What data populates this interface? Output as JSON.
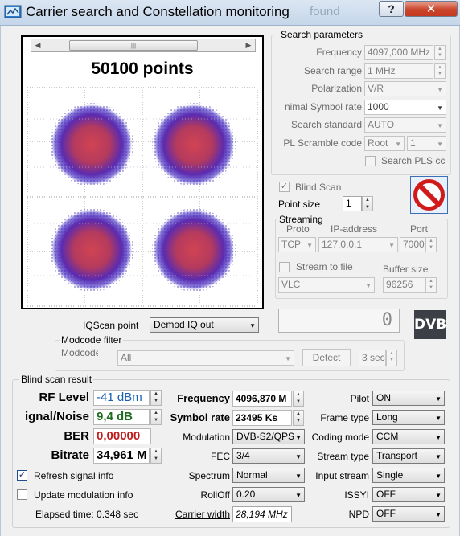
{
  "window": {
    "title": "Carrier search and Constellation monitoring",
    "background_text": "found",
    "help_label": "?",
    "close_label": "✕"
  },
  "plot": {
    "points_label": "50100 points",
    "scroll_thumb": "|||",
    "scroll_left": "◀",
    "scroll_right": "▶"
  },
  "search": {
    "group_label": "Search parameters",
    "frequency_label": "Frequency",
    "frequency_value": "4097,000 MHz",
    "range_label": "Search range",
    "range_value": "1 MHz",
    "polarization_label": "Polarization",
    "polarization_value": "V/R",
    "symbol_label": "nimal Symbol rate",
    "symbol_value": "1000",
    "standard_label": "Search standard",
    "standard_value": "AUTO",
    "pl_label": "PL Scramble code",
    "pl_mode": "Root",
    "pl_value": "1",
    "pls_label": "Search PLS cc"
  },
  "blind": {
    "label": "Blind Scan",
    "point_size_label": "Point size",
    "point_size_value": "1"
  },
  "streaming": {
    "group_label": "Streaming",
    "proto_header": "Proto",
    "ip_header": "IP-address",
    "port_header": "Port",
    "proto_value": "TCP",
    "ip_value": "127.0.0.1",
    "port_value": "7000",
    "to_file_label": "Stream to file",
    "buffer_label": "Buffer size",
    "player_value": "VLC",
    "buffer_value": "96256"
  },
  "iq": {
    "label": "IQScan point",
    "value": "Demod IQ out",
    "counter": "0"
  },
  "dvb_logo": "DVB",
  "modcode": {
    "group_label": "Modcode filter",
    "label": "Modcode",
    "value": "All",
    "detect_label": "Detect",
    "time_value": "3 sec"
  },
  "result": {
    "group_label": "Blind scan result",
    "rf_label": "RF Level",
    "rf_value": "-41 dBm",
    "snr_label": "ignal/Noise",
    "snr_value": "9,4 dB",
    "ber_label": "BER",
    "ber_value": "0,00000",
    "bitrate_label": "Bitrate",
    "bitrate_value": "34,961 M",
    "refresh_label": "Refresh signal info",
    "update_label": "Update modulation info",
    "elapsed_label": "Elapsed time: 0.348 sec",
    "freq_label": "Frequency",
    "freq_value": "4096,870 M",
    "sr_label": "Symbol rate",
    "sr_value": "23495 Ks",
    "modulation_label": "Modulation",
    "modulation_value": "DVB-S2/QPS",
    "fec_label": "FEC",
    "fec_value": "3/4",
    "spectrum_label": "Spectrum",
    "spectrum_value": "Normal",
    "rolloff_label": "RollOff",
    "rolloff_value": "0.20",
    "cw_label": "Carrier width",
    "cw_value": "28,194 MHz",
    "pilot_label": "Pilot",
    "pilot_value": "ON",
    "frame_label": "Frame type",
    "frame_value": "Long",
    "coding_label": "Coding mode",
    "coding_value": "CCM",
    "stream_label": "Stream type",
    "stream_value": "Transport",
    "input_label": "Input stream",
    "input_value": "Single",
    "issyi_label": "ISSYI",
    "issyi_value": "OFF",
    "npd_label": "NPD",
    "npd_value": "OFF"
  },
  "colors": {
    "rf_value": "#1a5fb4",
    "snr_value": "#1f6b1f",
    "ber_value": "#c01c1c",
    "constellation_core": "#c63a46",
    "constellation_edge": "#3a22b8"
  },
  "icons": {
    "stop": "stop-icon",
    "check": "✓",
    "dropdown": "▼",
    "up": "▲",
    "down": "▼"
  }
}
